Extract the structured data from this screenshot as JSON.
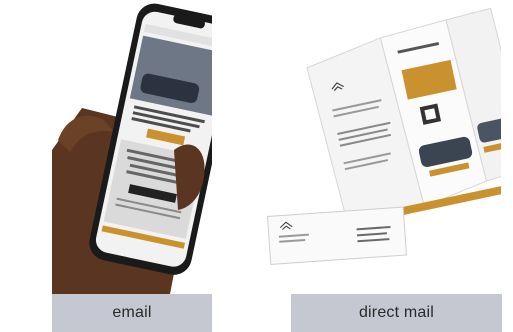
{
  "colors": {
    "accent_gold": "#c9922e",
    "caption_bar": "#c5c7d1",
    "phone_body": "#1a1a1a",
    "skin": "#5a3622"
  },
  "icons": {
    "brand_logo": "infiniti-logo-icon",
    "qr": "qr-code-icon"
  },
  "captions": {
    "email": "email",
    "direct_mail": "direct mail"
  }
}
